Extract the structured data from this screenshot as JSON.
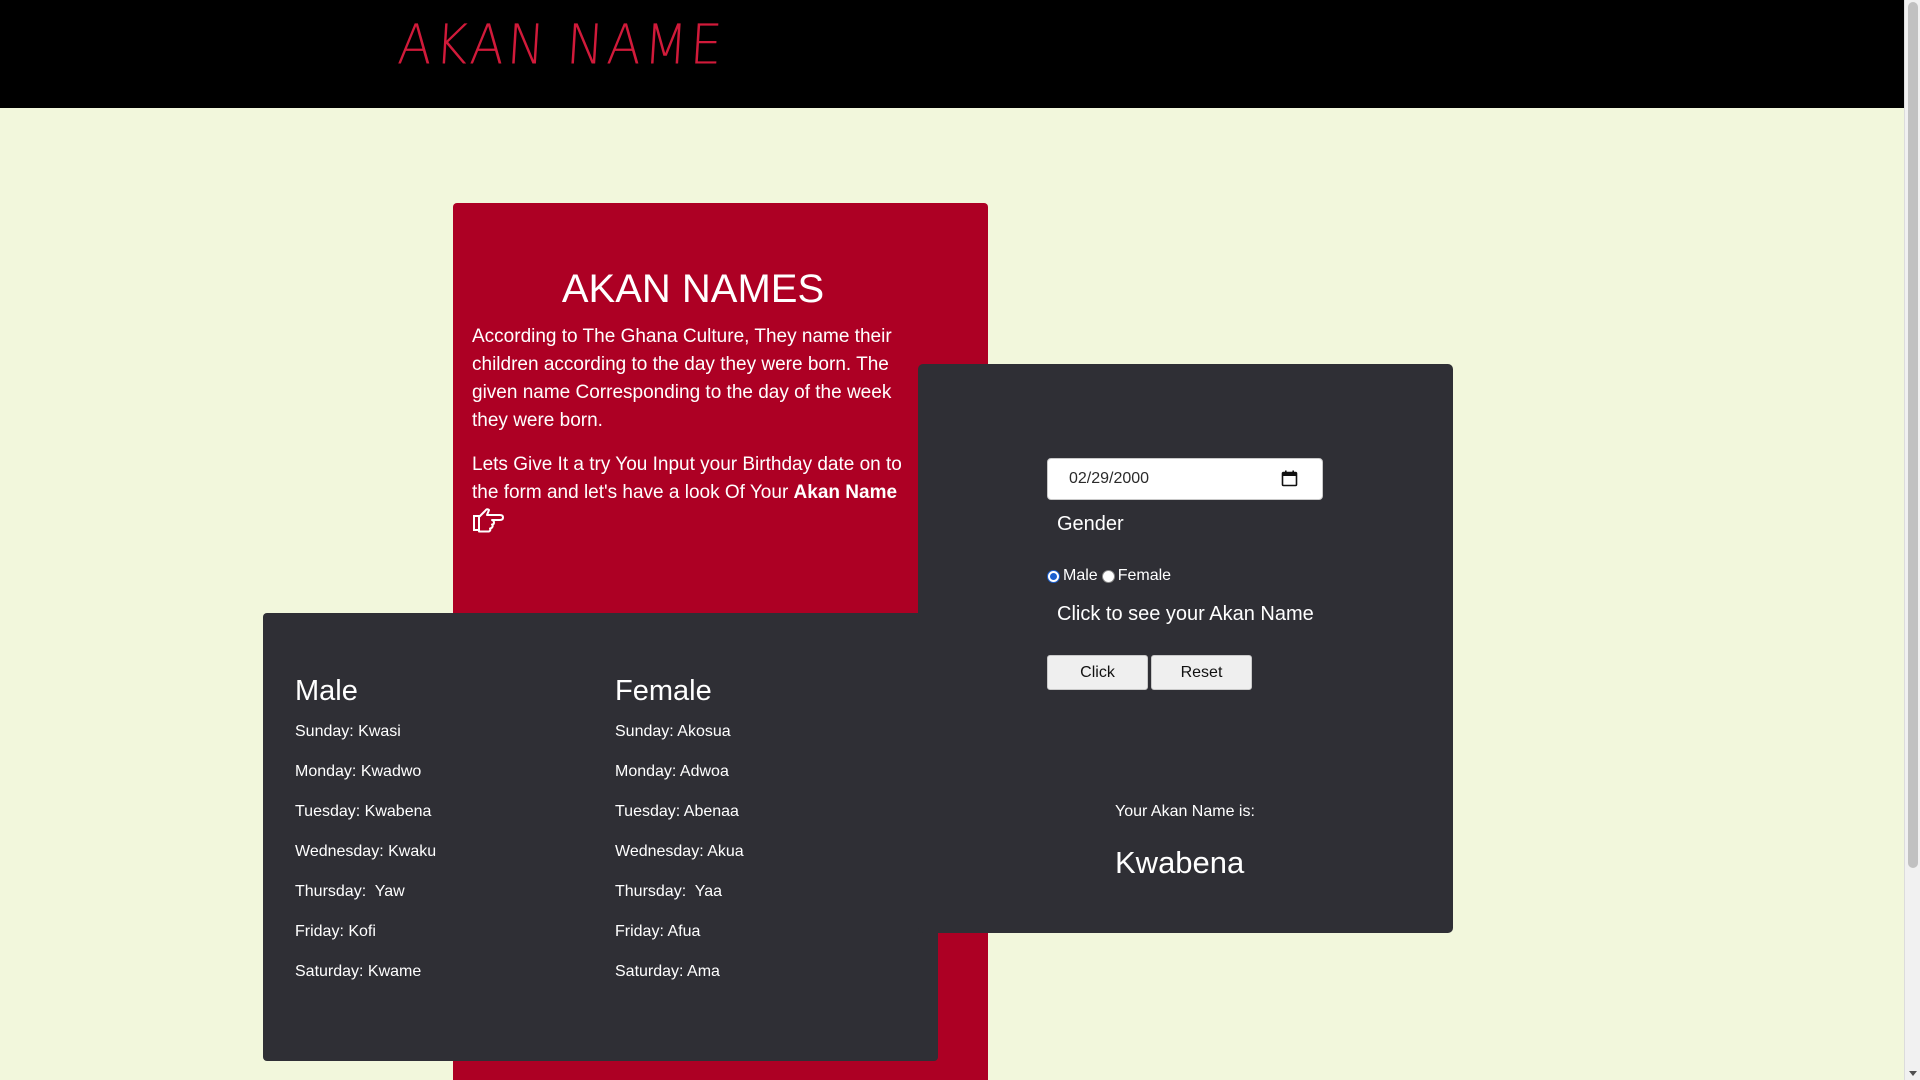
{
  "header": {
    "brand": "AKAN NAME"
  },
  "intro": {
    "title": "AKAN NAMES",
    "paragraph1": "According to The Ghana Culture, They name their children according to the day they were born. The given name Corresponding to the day of the week they were born.",
    "paragraph2_prefix": "Lets Give It a try You Input your Birthday date on to the form and let's have a look Of Your ",
    "paragraph2_bold": "Akan Name",
    "icon": "pointing-hand-icon"
  },
  "names": {
    "male": {
      "heading": "Male",
      "items": [
        "Sunday: Kwasi",
        "Monday: Kwadwo",
        "Tuesday: Kwabena",
        "Wednesday: Kwaku",
        "Thursday:  Yaw",
        "Friday: Kofi",
        "Saturday: Kwame"
      ]
    },
    "female": {
      "heading": "Female",
      "items": [
        "Sunday: Akosua",
        "Monday: Adwoa",
        "Tuesday: Abenaa",
        "Wednesday: Akua",
        "Thursday:  Yaa",
        "Friday: Afua",
        "Saturday: Ama"
      ]
    }
  },
  "form": {
    "date_value": "02/29/2000",
    "gender_label": "Gender",
    "male_label": "Male",
    "female_label": "Female",
    "selected_gender": "Male",
    "cta_text": "Click to see your Akan Name",
    "click_label": "Click",
    "reset_label": "Reset",
    "result_label": "Your Akan Name is:",
    "result_name": "Kwabena"
  },
  "colors": {
    "header_bg": "#000000",
    "brand": "#d11a3a",
    "page_bg": "#f2f7dc",
    "intro_bg": "#ad0024",
    "card_bg": "#2f2f35"
  }
}
